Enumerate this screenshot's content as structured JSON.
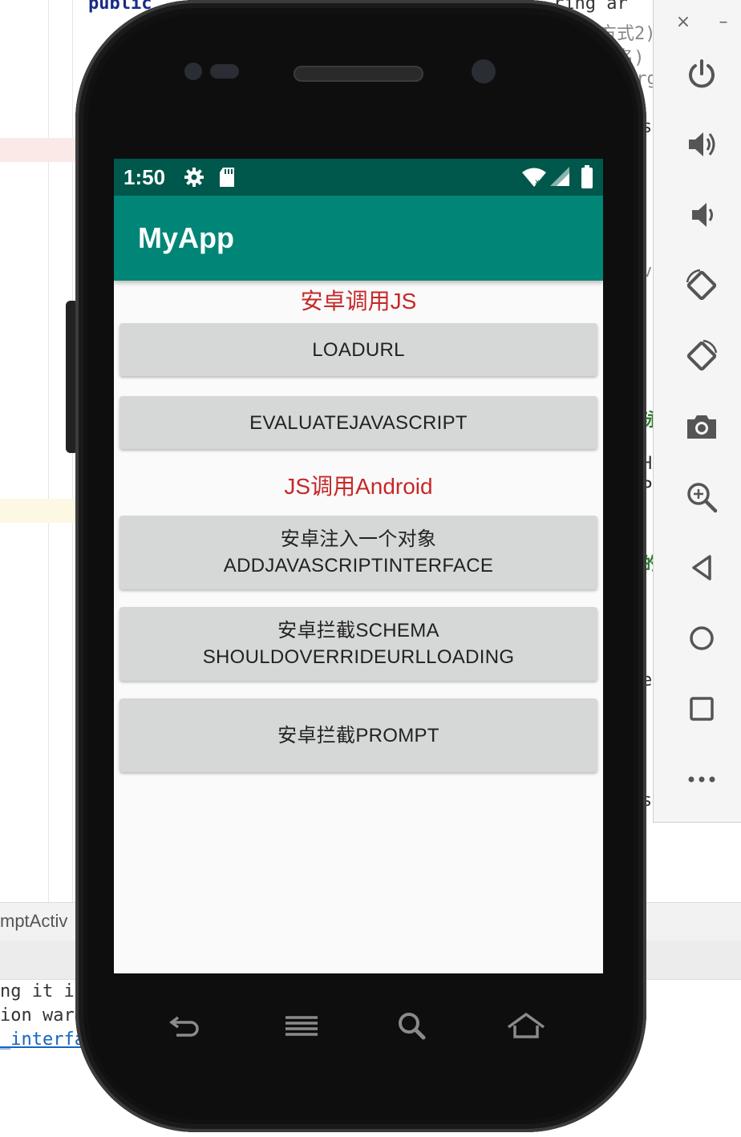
{
  "ide": {
    "code_top": "public",
    "code_right_lines": [
      "ring ar",
      "用方式2)",
      "(名)",
      "arg",
      "s",
      "v",
      "泳",
      "Ha",
      "Pa",
      "的",
      "e",
      "s"
    ],
    "tab_label": "mptActiv",
    "console_lines": [
      "ng it i",
      "ion war",
      "_interfa"
    ]
  },
  "side_panel": {
    "close": "×",
    "minimize": "–",
    "buttons": [
      {
        "name": "power-icon"
      },
      {
        "name": "volume-up-icon"
      },
      {
        "name": "volume-down-icon"
      },
      {
        "name": "rotate-left-icon"
      },
      {
        "name": "rotate-right-icon"
      },
      {
        "name": "camera-icon"
      },
      {
        "name": "zoom-icon"
      },
      {
        "name": "back-icon"
      },
      {
        "name": "home-icon"
      },
      {
        "name": "overview-icon"
      },
      {
        "name": "more-icon"
      }
    ]
  },
  "status_bar": {
    "time": "1:50"
  },
  "app": {
    "title": "MyApp",
    "section_android_to_js": "安卓调用JS",
    "btn_loadurl": "LOADURL",
    "btn_evaluate": "EVALUATEJAVASCRIPT",
    "section_js_to_android": "JS调用Android",
    "btn_inject_line1": "安卓注入一个对象",
    "btn_inject_line2": "ADDJAVASCRIPTINTERFACE",
    "btn_schema_line1": "安卓拦截SCHEMA",
    "btn_schema_line2": "SHOULDOVERRIDEURLLOADING",
    "btn_prompt": "安卓拦截PROMPT"
  },
  "colors": {
    "status_bar": "#00574b",
    "app_bar": "#008577",
    "section_label": "#c62828",
    "button": "#d6d7d7"
  }
}
